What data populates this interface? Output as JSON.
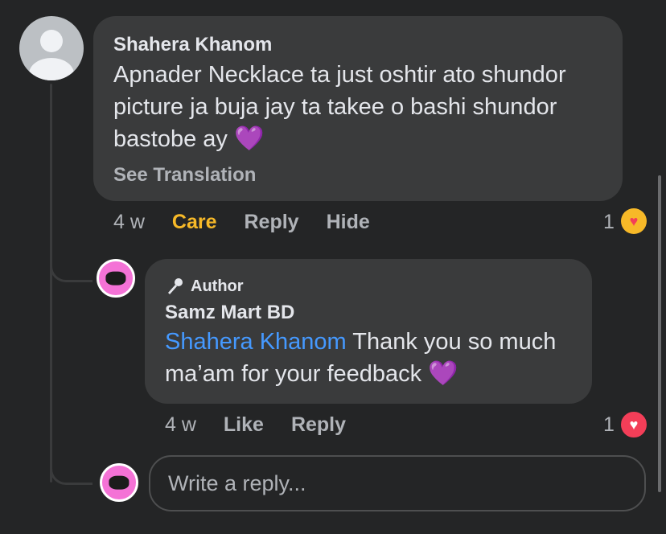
{
  "comment": {
    "author": "Shahera Khanom",
    "text_line1": "Apnader Necklace  ta just oshtir ato shundor",
    "text_line2": "picture ja buja jay ta takee o bashi shundor",
    "text_line3": "bastobe ay",
    "emoji": "💜",
    "see_translation": "See Translation",
    "time": "4 w",
    "reaction_label": "Care",
    "reply_label": "Reply",
    "hide_label": "Hide",
    "reaction_count": "1"
  },
  "reply": {
    "badge": "Author",
    "author": "Samz Mart BD",
    "mention": "Shahera Khanom",
    "text_line1": " Thank you so much",
    "text_line2": "ma’am for your feedback",
    "emoji": "💜",
    "time": "4 w",
    "like_label": "Like",
    "reply_label": "Reply",
    "reaction_count": "1"
  },
  "composer": {
    "placeholder": "Write a reply..."
  },
  "icons": {
    "care_reaction": "care-reaction-icon",
    "love_reaction": "love-reaction-icon",
    "author_badge": "microphone-icon"
  },
  "colors": {
    "background": "#242526",
    "bubble": "#3a3b3c",
    "care": "#f7b928",
    "mention": "#4599ff",
    "love": "#f33e58",
    "page_avatar": "#f472d6"
  }
}
